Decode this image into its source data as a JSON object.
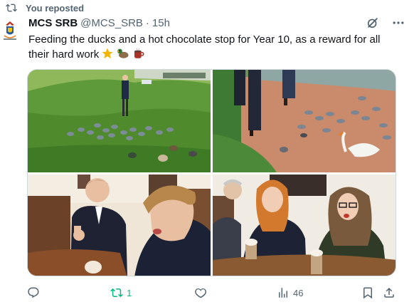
{
  "repost_banner": {
    "text": "You reposted"
  },
  "author": {
    "display_name": "MCS SRB",
    "handle": "@MCS_SRB",
    "separator": "·",
    "timestamp": "15h",
    "avatar_icon": "school-crest-icon"
  },
  "tweet": {
    "text": "Feeding the ducks and a hot chocolate stop for Year 10, as a reward for all their hard work",
    "emojis": [
      "star-emoji",
      "duck-emoji",
      "hot-chocolate-emoji"
    ]
  },
  "header_icons": [
    "grok-slash-icon",
    "more-icon"
  ],
  "media": [
    {
      "name": "photo-feeding-ducks-grass"
    },
    {
      "name": "photo-ducks-swan-riverbank"
    },
    {
      "name": "photo-students-hot-chocolate-1"
    },
    {
      "name": "photo-students-hot-chocolate-2"
    }
  ],
  "actions": {
    "reply": {
      "icon": "reply-icon",
      "count": ""
    },
    "repost": {
      "icon": "repost-icon",
      "count": "1",
      "color": "#00ba7c"
    },
    "like": {
      "icon": "heart-icon",
      "count": ""
    },
    "views": {
      "icon": "views-icon",
      "count": "46"
    },
    "bookmark": {
      "icon": "bookmark-icon"
    },
    "share": {
      "icon": "share-icon"
    }
  },
  "colors": {
    "secondary_text": "#536471",
    "primary_text": "#0f1419",
    "repost_green": "#00ba7c",
    "border": "#cfd9de"
  }
}
